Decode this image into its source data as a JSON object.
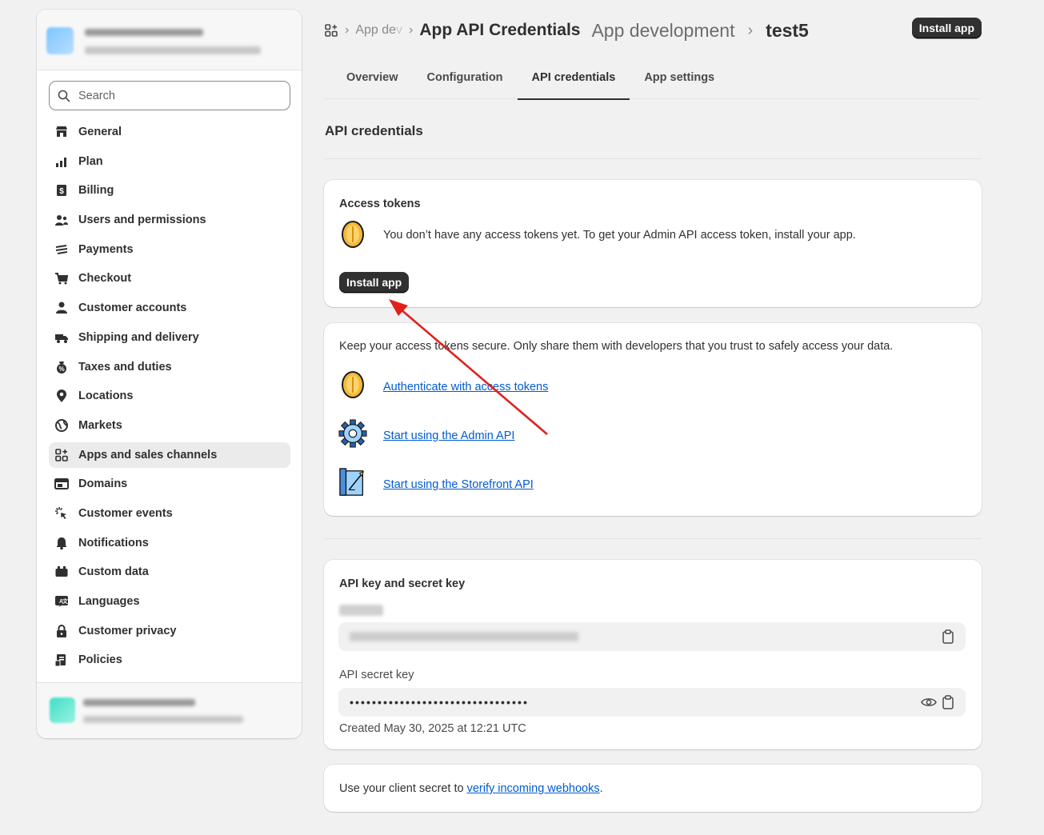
{
  "sidebar": {
    "search_placeholder": "Search",
    "items": [
      {
        "label": "General",
        "icon": "store-icon"
      },
      {
        "label": "Plan",
        "icon": "plan-chart-icon"
      },
      {
        "label": "Billing",
        "icon": "billing-receipt-icon"
      },
      {
        "label": "Users and permissions",
        "icon": "users-icon"
      },
      {
        "label": "Payments",
        "icon": "payments-icon"
      },
      {
        "label": "Checkout",
        "icon": "cart-icon"
      },
      {
        "label": "Customer accounts",
        "icon": "person-icon"
      },
      {
        "label": "Shipping and delivery",
        "icon": "truck-icon"
      },
      {
        "label": "Taxes and duties",
        "icon": "tax-bag-icon"
      },
      {
        "label": "Locations",
        "icon": "location-pin-icon"
      },
      {
        "label": "Markets",
        "icon": "globe-icon"
      },
      {
        "label": "Apps and sales channels",
        "icon": "apps-icon"
      },
      {
        "label": "Domains",
        "icon": "domains-icon"
      },
      {
        "label": "Customer events",
        "icon": "cursor-click-icon"
      },
      {
        "label": "Notifications",
        "icon": "bell-icon"
      },
      {
        "label": "Custom data",
        "icon": "custom-data-icon"
      },
      {
        "label": "Languages",
        "icon": "language-icon"
      },
      {
        "label": "Customer privacy",
        "icon": "lock-icon"
      },
      {
        "label": "Policies",
        "icon": "policies-icon"
      }
    ],
    "active_item": "Apps and sales channels"
  },
  "header": {
    "crumb_faded": "App de",
    "crumb_faded_tail": "v",
    "crumb_strong": "App API Credentials",
    "crumb_mid": "App development",
    "app_name": "test5",
    "install_label": "Install app"
  },
  "tabs": [
    {
      "label": "Overview",
      "active": false
    },
    {
      "label": "Configuration",
      "active": false
    },
    {
      "label": "API credentials",
      "active": true
    },
    {
      "label": "App settings",
      "active": false
    }
  ],
  "section_title": "API credentials",
  "access_tokens": {
    "title": "Access tokens",
    "message": "You don’t have any access tokens yet. To get your Admin API access token, install your app.",
    "install_label": "Install app"
  },
  "resources": {
    "intro": "Keep your access tokens secure. Only share them with developers that you trust to safely access your data.",
    "links": [
      {
        "label": "Authenticate with access tokens",
        "icon": "coin-icon"
      },
      {
        "label": "Start using the Admin API",
        "icon": "gear-icon"
      },
      {
        "label": "Start using the Storefront API",
        "icon": "storefront-blueprint-icon"
      }
    ]
  },
  "keys": {
    "title": "API key and secret key",
    "secret_label": "API secret key",
    "secret_masked": "••••••••••••••••••••••••••••••••",
    "created": "Created May 30, 2025 at 12:21 UTC"
  },
  "webhooks": {
    "prefix": "Use your client secret to ",
    "link": "verify incoming webhooks",
    "suffix": "."
  },
  "colors": {
    "accent_link": "#005bd3",
    "dark_button": "#303030",
    "annotation_arrow": "#e0201b"
  }
}
